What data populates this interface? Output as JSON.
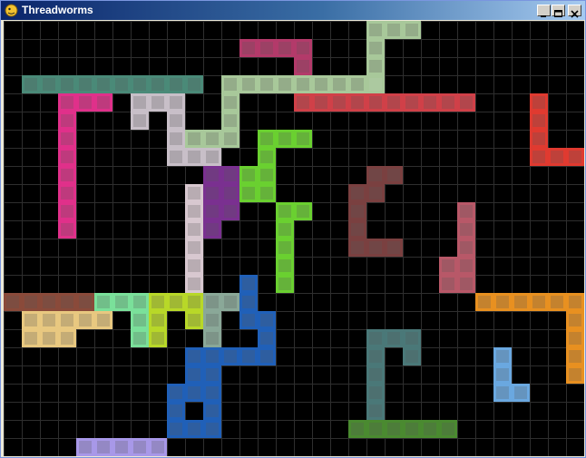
{
  "window": {
    "title": "Threadworms",
    "icon": "pygame-snake-icon",
    "controls": {
      "minimize": "minimize-icon",
      "maximize": "maximize-icon",
      "close": "close-icon"
    }
  },
  "board": {
    "columns": 32,
    "rows": 24,
    "background": "#000000",
    "grid_color": "#2e2e2e"
  },
  "worms": [
    {
      "color": "#a8c89a",
      "cells": [
        [
          20,
          0
        ],
        [
          21,
          0
        ],
        [
          22,
          0
        ],
        [
          20,
          1
        ],
        [
          20,
          2
        ],
        [
          20,
          3
        ]
      ]
    },
    {
      "color": "#a8c89a",
      "cells": [
        [
          12,
          3
        ],
        [
          13,
          3
        ],
        [
          14,
          3
        ],
        [
          15,
          3
        ],
        [
          16,
          3
        ],
        [
          17,
          3
        ],
        [
          18,
          3
        ],
        [
          19,
          3
        ],
        [
          20,
          3
        ],
        [
          12,
          4
        ],
        [
          12,
          5
        ],
        [
          12,
          6
        ],
        [
          11,
          6
        ],
        [
          10,
          6
        ]
      ]
    },
    {
      "color": "#b33a6a",
      "cells": [
        [
          13,
          1
        ],
        [
          14,
          1
        ],
        [
          15,
          1
        ],
        [
          16,
          1
        ],
        [
          16,
          2
        ]
      ]
    },
    {
      "color": "#4a8a78",
      "cells": [
        [
          1,
          3
        ],
        [
          2,
          3
        ],
        [
          3,
          3
        ],
        [
          4,
          3
        ],
        [
          5,
          3
        ],
        [
          6,
          3
        ],
        [
          7,
          3
        ],
        [
          8,
          3
        ],
        [
          9,
          3
        ],
        [
          10,
          3
        ]
      ]
    },
    {
      "color": "#e0308a",
      "cells": [
        [
          3,
          4
        ],
        [
          4,
          4
        ],
        [
          5,
          4
        ],
        [
          3,
          5
        ],
        [
          3,
          6
        ],
        [
          3,
          7
        ],
        [
          3,
          8
        ],
        [
          3,
          9
        ],
        [
          3,
          10
        ],
        [
          3,
          11
        ]
      ]
    },
    {
      "color": "#c8bfc8",
      "cells": [
        [
          7,
          4
        ],
        [
          8,
          4
        ],
        [
          9,
          4
        ],
        [
          7,
          5
        ],
        [
          9,
          5
        ],
        [
          9,
          6
        ],
        [
          9,
          7
        ],
        [
          10,
          7
        ],
        [
          11,
          7
        ]
      ]
    },
    {
      "color": "#d04048",
      "cells": [
        [
          16,
          4
        ],
        [
          17,
          4
        ],
        [
          18,
          4
        ],
        [
          19,
          4
        ],
        [
          20,
          4
        ],
        [
          21,
          4
        ],
        [
          22,
          4
        ],
        [
          23,
          4
        ],
        [
          24,
          4
        ],
        [
          25,
          4
        ]
      ]
    },
    {
      "color": "#e03a30",
      "cells": [
        [
          29,
          4
        ],
        [
          29,
          5
        ],
        [
          29,
          6
        ],
        [
          29,
          7
        ],
        [
          30,
          7
        ],
        [
          31,
          7
        ]
      ]
    },
    {
      "color": "#6ad030",
      "cells": [
        [
          14,
          6
        ],
        [
          15,
          6
        ],
        [
          16,
          6
        ],
        [
          14,
          7
        ],
        [
          14,
          8
        ],
        [
          13,
          8
        ],
        [
          13,
          9
        ],
        [
          14,
          9
        ]
      ]
    },
    {
      "color": "#7a3090",
      "cells": [
        [
          11,
          8
        ],
        [
          12,
          8
        ],
        [
          11,
          9
        ],
        [
          12,
          9
        ],
        [
          11,
          10
        ],
        [
          12,
          10
        ],
        [
          11,
          11
        ]
      ]
    },
    {
      "color": "#d8c8d0",
      "cells": [
        [
          10,
          9
        ],
        [
          10,
          10
        ],
        [
          10,
          11
        ],
        [
          10,
          12
        ],
        [
          10,
          13
        ],
        [
          10,
          14
        ]
      ]
    },
    {
      "color": "#6ad030",
      "cells": [
        [
          15,
          10
        ],
        [
          16,
          10
        ],
        [
          15,
          11
        ],
        [
          15,
          12
        ],
        [
          15,
          13
        ],
        [
          15,
          14
        ]
      ]
    },
    {
      "color": "#7a4040",
      "cells": [
        [
          20,
          8
        ],
        [
          21,
          8
        ],
        [
          19,
          9
        ],
        [
          20,
          9
        ],
        [
          19,
          10
        ],
        [
          19,
          11
        ],
        [
          19,
          12
        ],
        [
          20,
          12
        ],
        [
          21,
          12
        ]
      ]
    },
    {
      "color": "#b85868",
      "cells": [
        [
          25,
          10
        ],
        [
          25,
          11
        ],
        [
          25,
          12
        ],
        [
          25,
          13
        ],
        [
          24,
          13
        ],
        [
          24,
          14
        ],
        [
          25,
          14
        ]
      ]
    },
    {
      "color": "#8a4a3a",
      "cells": [
        [
          0,
          15
        ],
        [
          1,
          15
        ],
        [
          2,
          15
        ],
        [
          3,
          15
        ],
        [
          4,
          15
        ]
      ]
    },
    {
      "color": "#7ae09a",
      "cells": [
        [
          5,
          15
        ],
        [
          6,
          15
        ],
        [
          7,
          15
        ],
        [
          7,
          16
        ],
        [
          7,
          17
        ]
      ]
    },
    {
      "color": "#e8c880",
      "cells": [
        [
          1,
          16
        ],
        [
          2,
          16
        ],
        [
          3,
          16
        ],
        [
          4,
          16
        ],
        [
          5,
          16
        ],
        [
          1,
          17
        ],
        [
          2,
          17
        ],
        [
          3,
          17
        ]
      ]
    },
    {
      "color": "#b8d828",
      "cells": [
        [
          8,
          15
        ],
        [
          9,
          15
        ],
        [
          10,
          15
        ],
        [
          8,
          16
        ],
        [
          10,
          16
        ],
        [
          8,
          17
        ]
      ]
    },
    {
      "color": "#8aa898",
      "cells": [
        [
          11,
          15
        ],
        [
          12,
          15
        ],
        [
          11,
          16
        ],
        [
          11,
          17
        ]
      ]
    },
    {
      "color": "#2060b8",
      "cells": [
        [
          13,
          14
        ],
        [
          13,
          15
        ],
        [
          13,
          16
        ],
        [
          14,
          16
        ],
        [
          14,
          17
        ],
        [
          14,
          18
        ],
        [
          13,
          18
        ],
        [
          12,
          18
        ],
        [
          11,
          18
        ],
        [
          10,
          18
        ],
        [
          10,
          19
        ],
        [
          11,
          19
        ],
        [
          11,
          20
        ],
        [
          11,
          21
        ],
        [
          11,
          22
        ],
        [
          10,
          22
        ],
        [
          9,
          22
        ],
        [
          9,
          21
        ],
        [
          9,
          20
        ],
        [
          10,
          20
        ]
      ]
    },
    {
      "color": "#4a7878",
      "cells": [
        [
          20,
          17
        ],
        [
          21,
          17
        ],
        [
          22,
          17
        ],
        [
          22,
          18
        ],
        [
          20,
          18
        ],
        [
          20,
          19
        ],
        [
          20,
          20
        ],
        [
          20,
          21
        ]
      ]
    },
    {
      "color": "#4a8a30",
      "cells": [
        [
          19,
          22
        ],
        [
          20,
          22
        ],
        [
          21,
          22
        ],
        [
          22,
          22
        ],
        [
          23,
          22
        ],
        [
          24,
          22
        ]
      ]
    },
    {
      "color": "#e89020",
      "cells": [
        [
          26,
          15
        ],
        [
          27,
          15
        ],
        [
          28,
          15
        ],
        [
          29,
          15
        ],
        [
          30,
          15
        ],
        [
          31,
          15
        ],
        [
          31,
          16
        ],
        [
          31,
          17
        ],
        [
          31,
          18
        ],
        [
          31,
          19
        ]
      ]
    },
    {
      "color": "#6aa8e0",
      "cells": [
        [
          27,
          18
        ],
        [
          27,
          19
        ],
        [
          27,
          20
        ],
        [
          28,
          20
        ]
      ]
    },
    {
      "color": "#a898e8",
      "cells": [
        [
          4,
          23
        ],
        [
          5,
          23
        ],
        [
          6,
          23
        ],
        [
          7,
          23
        ],
        [
          8,
          23
        ]
      ]
    }
  ]
}
